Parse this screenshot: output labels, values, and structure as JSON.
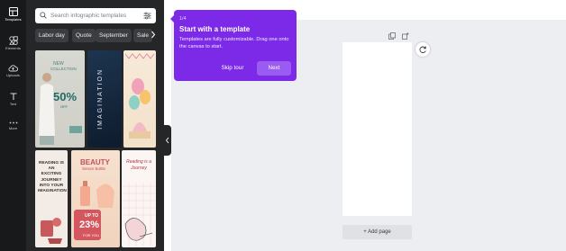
{
  "rail": {
    "items": [
      {
        "label": "Templates",
        "icon": "layout-icon"
      },
      {
        "label": "Elements",
        "icon": "shapes-icon"
      },
      {
        "label": "Uploads",
        "icon": "cloud-upload-icon"
      },
      {
        "label": "Text",
        "icon": "text-icon"
      },
      {
        "label": "More",
        "icon": "more-dots-icon"
      }
    ]
  },
  "panel": {
    "search_placeholder": "Search infographic templates",
    "chips": [
      "Labor day",
      "Quote",
      "September",
      "Sale"
    ],
    "templates": {
      "t1": {
        "line1": "NEW",
        "line2": "COLLECTION",
        "big": "50%",
        "sub": "OFF"
      },
      "t2": {
        "vertical": "IMAGINATION"
      },
      "t4": {
        "text": "READING IS AN EXCITING JOURNEY INTO YOUR IMAGINATION"
      },
      "t5": {
        "line1": "BEAUTY",
        "line2": "Serum Bottle",
        "line3": "UP TO",
        "big": "23%",
        "sub": "FOR YOU"
      },
      "t6": {
        "text": "Reading is a Journey"
      }
    }
  },
  "canvas": {
    "add_page_label": "+ Add page"
  },
  "tour": {
    "step": "1/4",
    "title": "Start with a template",
    "body": "Templates are fully customizable. Drag one onto the canvas to start.",
    "skip_label": "Skip tour",
    "next_label": "Next"
  },
  "colors": {
    "accent": "#7d2ae8",
    "rail_bg": "#18191b",
    "panel_bg": "#252627",
    "canvas_bg": "#eceef1"
  }
}
